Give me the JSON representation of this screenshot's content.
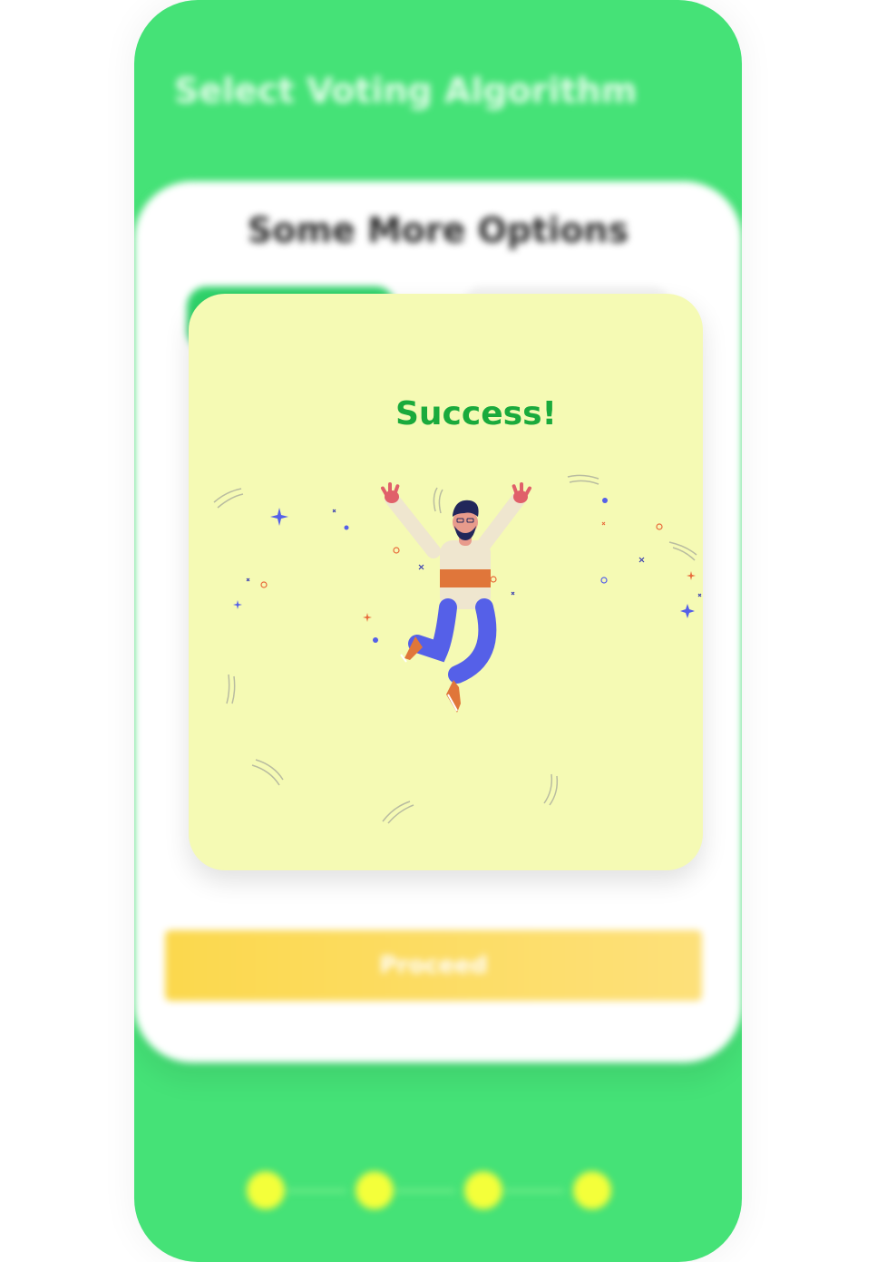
{
  "screen": {
    "title": "Select Voting Algorithm",
    "panel_title": "Some More Options",
    "proceed_label": "Proceed",
    "stepper_steps": 4
  },
  "modal": {
    "title": "Success!",
    "illustration": "jumping-man-celebration"
  },
  "colors": {
    "brand_green": "#45e277",
    "success_text": "#1aaa3c",
    "modal_bg": "#f5fab4",
    "step_dot": "#f4ff3a",
    "proceed_yellow": "#fbd84d"
  }
}
